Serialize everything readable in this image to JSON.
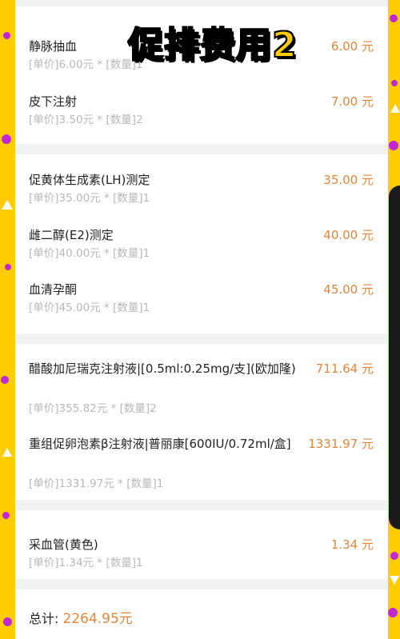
{
  "banner": "促排费用2",
  "groups": [
    {
      "items": [
        {
          "name": "静脉抽血",
          "price": "6.00 元",
          "meta": "[单价]6.00元 * [数量]1"
        },
        {
          "name": "皮下注射",
          "price": "7.00 元",
          "meta": "[单价]3.50元 * [数量]2"
        }
      ]
    },
    {
      "items": [
        {
          "name": "促黄体生成素(LH)测定",
          "price": "35.00 元",
          "meta": "[单价]35.00元 * [数量]1"
        },
        {
          "name": "雌二醇(E2)测定",
          "price": "40.00 元",
          "meta": "[单价]40.00元 * [数量]1"
        },
        {
          "name": "血清孕酮",
          "price": "45.00 元",
          "meta": "[单价]45.00元 * [数量]1"
        }
      ]
    },
    {
      "items": [
        {
          "name": "醋酸加尼瑞克注射液|[0.5ml:0.25mg/支](欧加隆)",
          "price": "711.64 元",
          "meta": "[单价]355.82元 * [数量]2"
        },
        {
          "name": "重组促卵泡素β注射液|普丽康[600IU/0.72ml/盒]",
          "price": "1331.97 元",
          "meta": "[单价]1331.97元 * [数量]1"
        }
      ]
    },
    {
      "items": [
        {
          "name": "采血管(黄色)",
          "price": "1.34 元",
          "meta": "[单价]1.34元 * [数量]1"
        }
      ]
    }
  ],
  "total": {
    "label": "总计:",
    "amount": "2264.95元"
  }
}
